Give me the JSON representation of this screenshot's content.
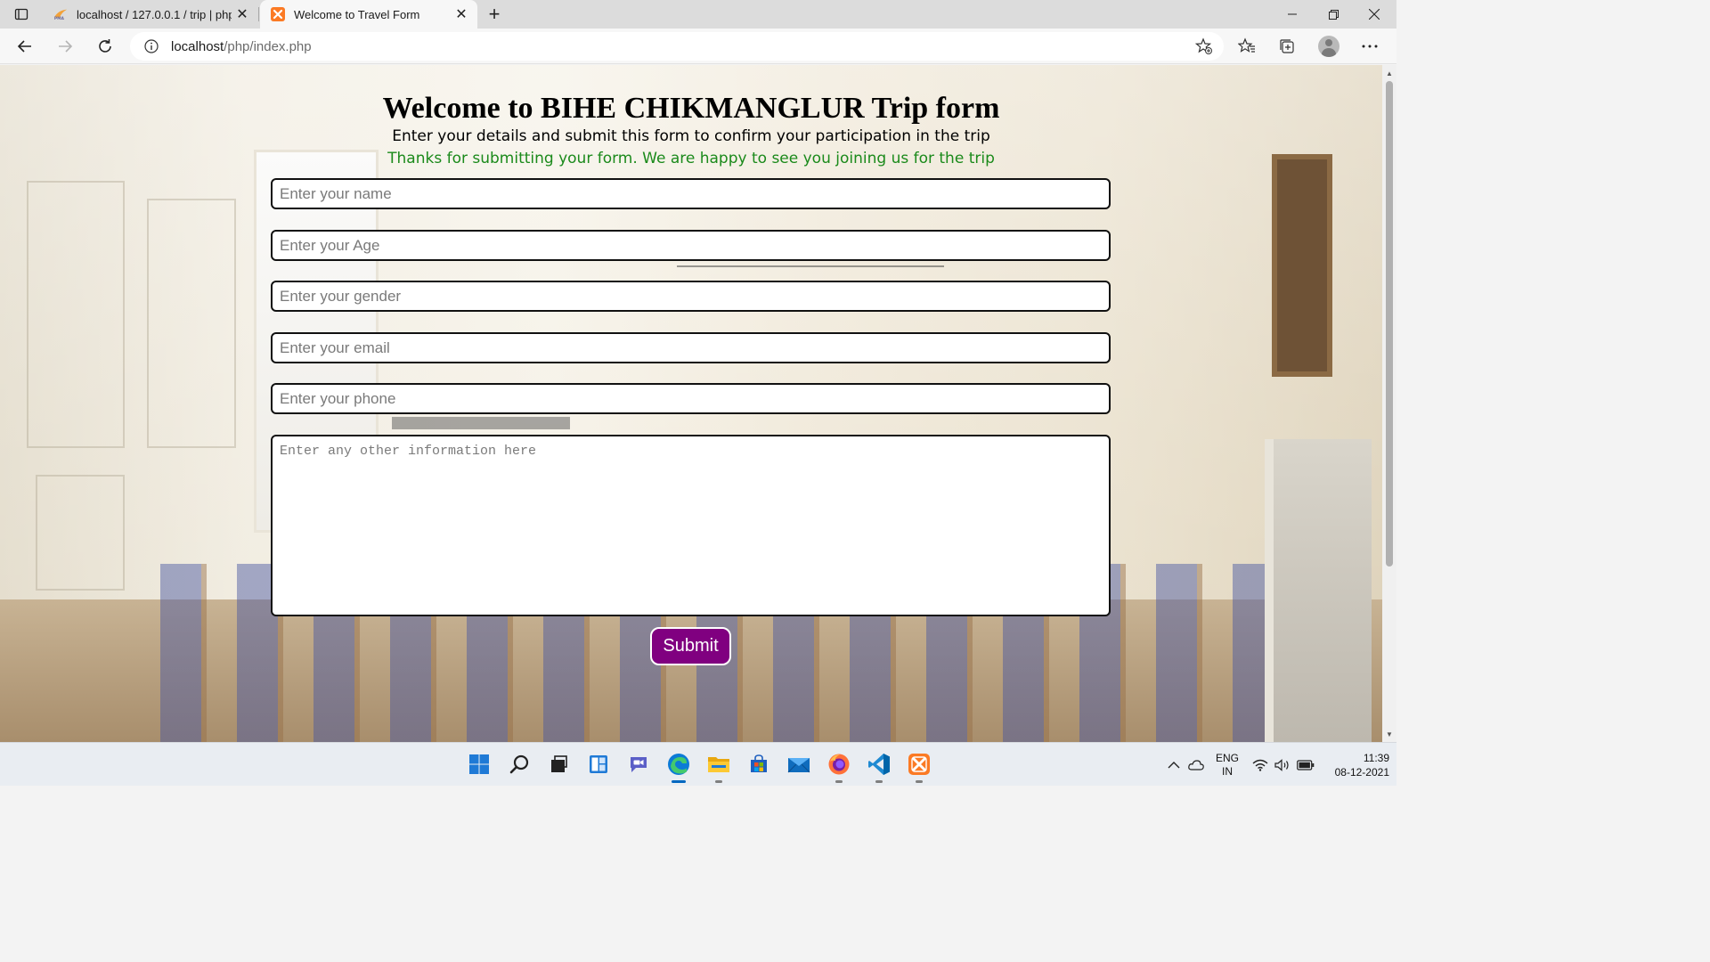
{
  "browser": {
    "tabs": [
      {
        "title": "localhost / 127.0.0.1 / trip | phpMyAdmin",
        "favicon": "pma-icon",
        "active": false
      },
      {
        "title": "Welcome to Travel Form",
        "favicon": "xampp-icon",
        "active": true
      }
    ],
    "address": {
      "host": "localhost",
      "path": "/php/index.php"
    }
  },
  "page": {
    "heading": "Welcome to BIHE CHIKMANGLUR Trip form",
    "subheading": "Enter your details and submit this form to confirm your participation in the trip",
    "thanks": "Thanks for submitting your form. We are happy to see you joining us for the trip",
    "fields": {
      "name_placeholder": "Enter your name",
      "age_placeholder": "Enter your Age",
      "gender_placeholder": "Enter your gender",
      "email_placeholder": "Enter your email",
      "phone_placeholder": "Enter your phone",
      "info_placeholder": "Enter any other information here"
    },
    "submit_label": "Submit"
  },
  "taskbar": {
    "apps": [
      "start-icon",
      "search-icon",
      "task-view-icon",
      "widgets-icon",
      "chat-icon",
      "edge-icon",
      "file-explorer-icon",
      "store-icon",
      "mail-icon",
      "firefox-icon",
      "vscode-icon",
      "xampp-icon"
    ],
    "lang_line1": "ENG",
    "lang_line2": "IN",
    "time": "11:39",
    "date": "08-12-2021"
  },
  "colors": {
    "submit_bg": "#800080",
    "thanks_text": "#1b8a1b",
    "edge_blue": "#0067c0"
  }
}
